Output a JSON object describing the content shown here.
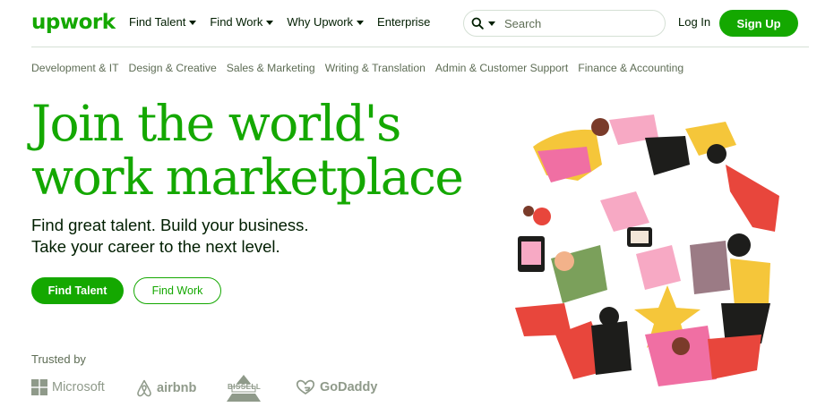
{
  "header": {
    "logo": "upwork",
    "nav": [
      {
        "label": "Find Talent",
        "has_menu": true
      },
      {
        "label": "Find Work",
        "has_menu": true
      },
      {
        "label": "Why Upwork",
        "has_menu": true
      },
      {
        "label": "Enterprise",
        "has_menu": false
      }
    ],
    "search": {
      "placeholder": "Search",
      "icon": "search-icon"
    },
    "login": "Log In",
    "signup": "Sign Up"
  },
  "categories": [
    "Development & IT",
    "Design & Creative",
    "Sales & Marketing",
    "Writing & Translation",
    "Admin & Customer Support",
    "Finance & Accounting"
  ],
  "hero": {
    "headline_line1": "Join the world's",
    "headline_line2": "work marketplace",
    "sub_line1": "Find great talent. Build your business.",
    "sub_line2": "Take your career to the next level.",
    "primary_button": "Find Talent",
    "secondary_button": "Find Work"
  },
  "trusted": {
    "label": "Trusted by",
    "brands": [
      "Microsoft",
      "airbnb",
      "BISSELL",
      "GoDaddy"
    ]
  },
  "colors": {
    "brand_green": "#14a800",
    "text_dark": "#001e00",
    "text_muted": "#5e6d55",
    "logo_gray": "#8f9a8a"
  }
}
